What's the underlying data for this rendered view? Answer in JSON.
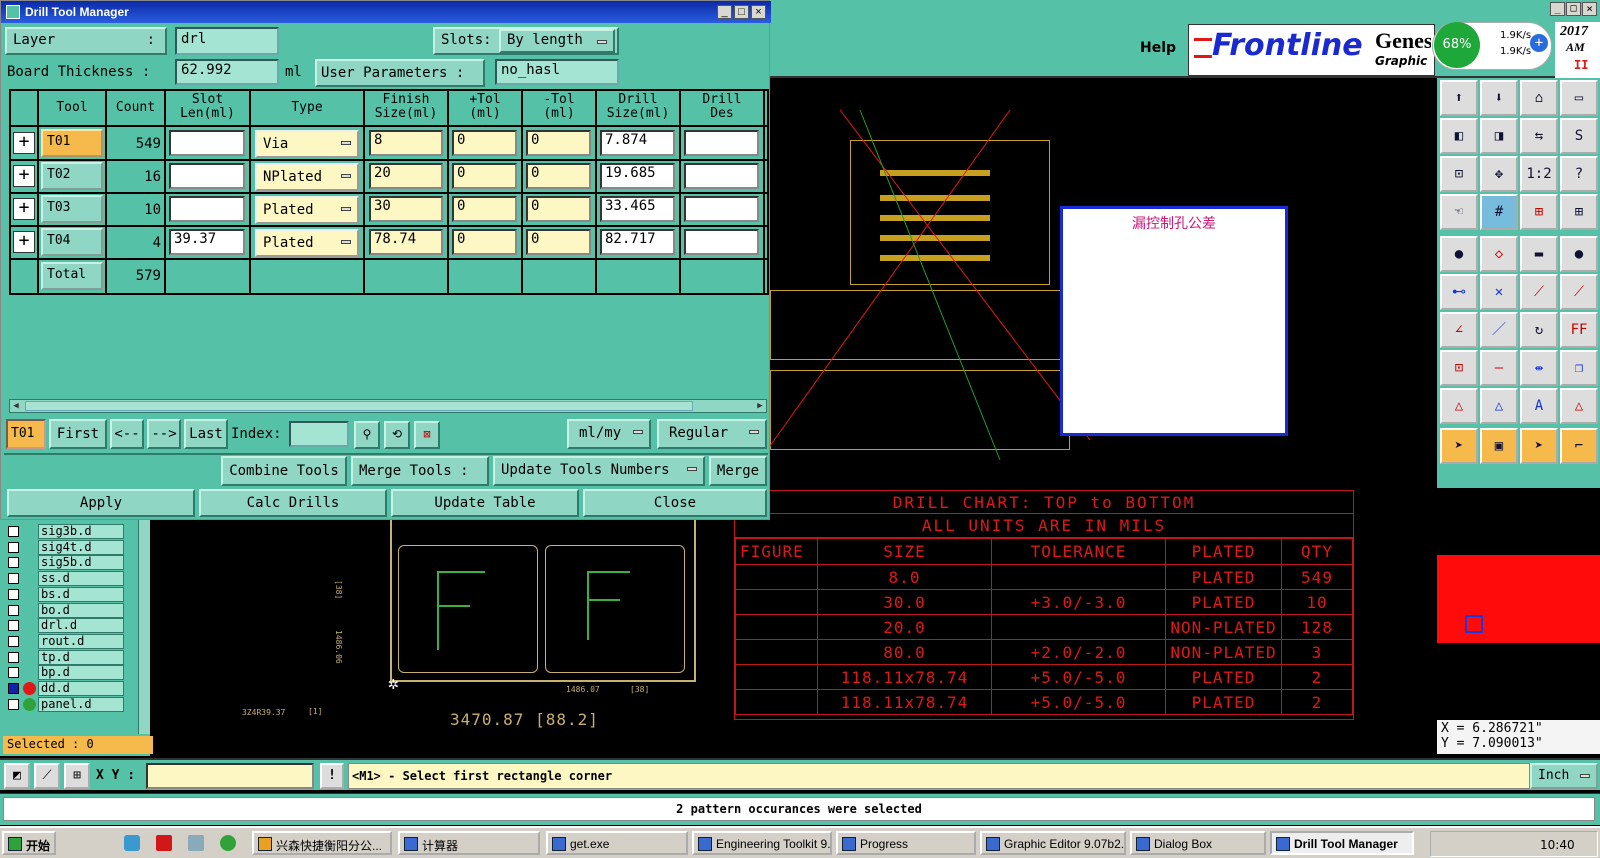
{
  "dtm": {
    "title": "Drill Tool Manager",
    "layer_label": "Layer",
    "layer_sep": ":",
    "layer_value": "drl",
    "slots_label": "Slots:",
    "slots_value": "By length",
    "board_thickness_label": "Board Thickness :",
    "board_thickness_value": "62.992",
    "board_thickness_unit": "ml",
    "user_params_label": "User Parameters :",
    "user_params_value": "no_hasl",
    "columns": [
      "Tool",
      "Count",
      "Slot\nLen(ml)",
      "Type",
      "Finish\nSize(ml)",
      "+Tol\n(ml)",
      "-Tol\n(ml)",
      "Drill\nSize(ml)",
      "Drill\nDes"
    ],
    "rows": [
      {
        "tool": "T01",
        "count": "549",
        "slot": "",
        "type": "Via",
        "finish": "8",
        "ptol": "0",
        "ntol": "0",
        "drill": "7.874"
      },
      {
        "tool": "T02",
        "count": "16",
        "slot": "",
        "type": "NPlated",
        "finish": "20",
        "ptol": "0",
        "ntol": "0",
        "drill": "19.685"
      },
      {
        "tool": "T03",
        "count": "10",
        "slot": "",
        "type": "Plated",
        "finish": "30",
        "ptol": "0",
        "ntol": "0",
        "drill": "33.465"
      },
      {
        "tool": "T04",
        "count": "4",
        "slot": "39.37",
        "type": "Plated",
        "finish": "78.74",
        "ptol": "0",
        "ntol": "0",
        "drill": "82.717"
      }
    ],
    "total_label": "Total",
    "total_count": "579",
    "current_tool": "T01",
    "nav": {
      "first": "First",
      "prev": "<--",
      "next": "-->",
      "last": "Last",
      "index": "Index:"
    },
    "units_value": "ml/my",
    "mode_value": "Regular",
    "combine_tools": "Combine Tools",
    "merge_tools": "Merge Tools :",
    "update_numbers": "Update Tools Numbers",
    "merge": "Merge",
    "apply": "Apply",
    "calc_drills": "Calc Drills",
    "update_table": "Update Table",
    "close": "Close"
  },
  "header": {
    "help": "Help",
    "logo": "Frontline",
    "product": "Genesis",
    "product_sub": "Graphic E",
    "net_percent": "68%",
    "net_up": "1.9K/s",
    "net_down": "1.9K/s",
    "clock_year": "2017",
    "clock_ampm": "AM"
  },
  "layers": {
    "items": [
      "sig3b.d",
      "sig4t.d",
      "sig5b.d",
      "ss.d",
      "bs.d",
      "bo.d",
      "drl.d",
      "rout.d",
      "tp.d",
      "bp.d",
      "dd.d",
      "panel.d"
    ],
    "selected_label": "Selected : 0"
  },
  "cad": {
    "annotation_box_title": "漏控制孔公差",
    "drill_chart_title": "DRILL CHART: TOP to BOTTOM",
    "drill_chart_sub": "ALL UNITS ARE IN MILS",
    "drill_chart_headers": [
      "FIGURE",
      "SIZE",
      "TOLERANCE",
      "PLATED",
      "QTY"
    ],
    "drill_chart_rows": [
      [
        "",
        "8.0",
        "",
        "PLATED",
        "549"
      ],
      [
        "",
        "30.0",
        "+3.0/-3.0",
        "PLATED",
        "10"
      ],
      [
        "",
        "20.0",
        "",
        "NON-PLATED",
        "128"
      ],
      [
        "",
        "80.0",
        "+2.0/-2.0",
        "NON-PLATED",
        "3"
      ],
      [
        "",
        "118.11x78.74",
        "+5.0/-5.0",
        "PLATED",
        "2"
      ],
      [
        "",
        "118.11x78.74",
        "+5.0/-5.0",
        "PLATED",
        "2"
      ]
    ],
    "dim_main": "3470.87 [88.2]",
    "dim_small1": "1486.07",
    "dim_small2": "[38]",
    "dim_left": "3Z4R39.37",
    "dim_bracket": "[1]",
    "dim_v1": "[38]",
    "dim_v2": "1486.06"
  },
  "status": {
    "xy_label": "X Y :",
    "xy_value": "",
    "prompt": "<M1> - Select first rectangle corner",
    "units": "Inch",
    "message": "2 pattern occurances were selected",
    "x_coord": "X = 6.286721\"",
    "y_coord": "Y = 7.090013\""
  },
  "taskbar": {
    "start": "开始",
    "tasks": [
      "兴森快捷衡阳分公...",
      "计算器",
      "get.exe",
      "Engineering Toolkit 9....",
      "Progress",
      "Graphic Editor 9.07b2...",
      "Dialog Box",
      "Drill Tool Manager"
    ],
    "time": "10:40"
  },
  "colors": {
    "panel": "#55c2a8",
    "accent_red": "#e01818",
    "highlight": "#f6b94b"
  }
}
